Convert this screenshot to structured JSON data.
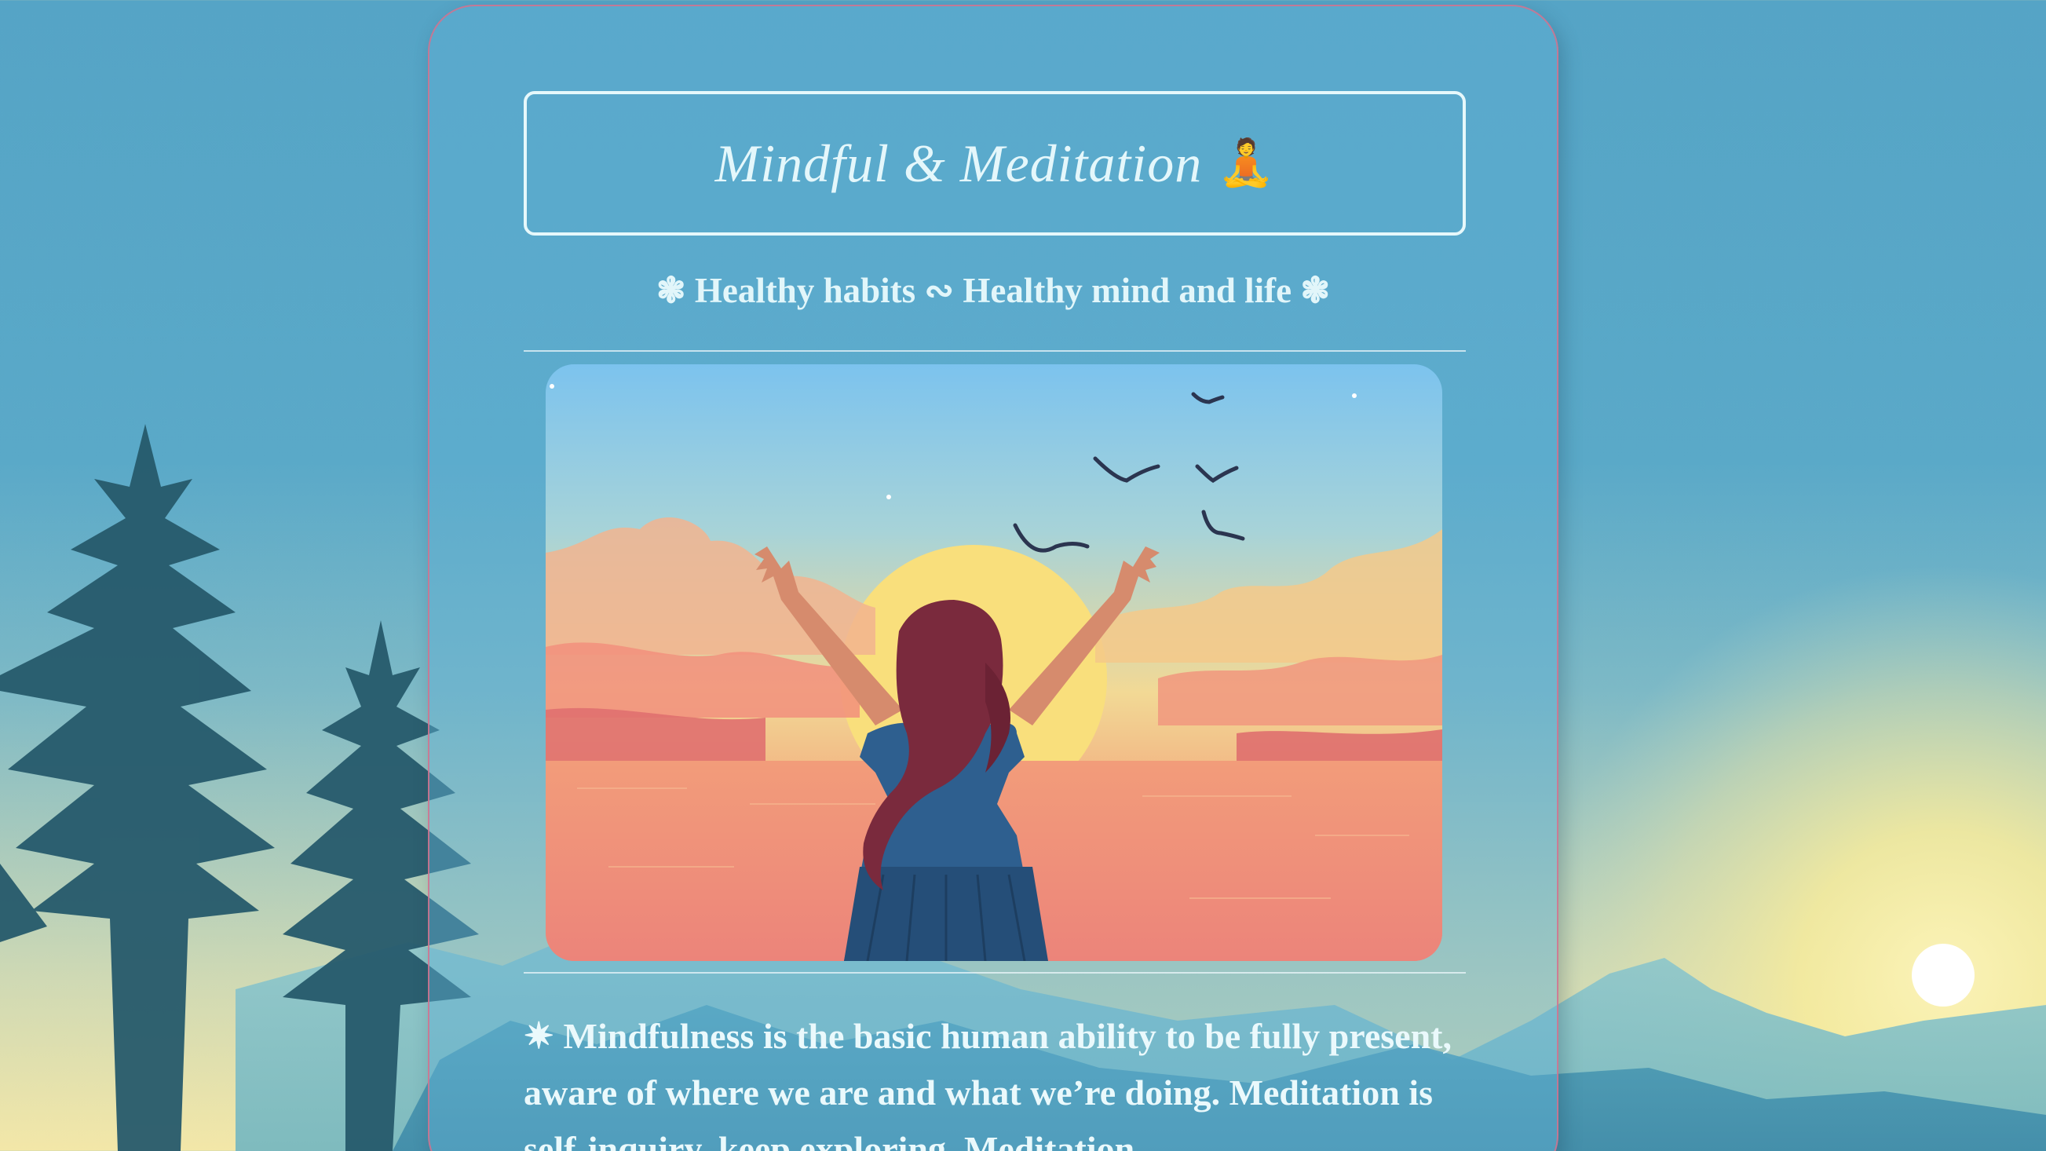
{
  "page": {
    "title": "Mindful & Meditation",
    "title_emoji": "🧘",
    "subtitle": "❃ Healthy habits ∾ Healthy mind and life ❃",
    "body_bullet": "✷",
    "body_text": "Mindfulness is the basic human ability to be fully present, aware of where we are and what we’re doing. Meditation is self-inquiry, keep exploring. Meditation"
  },
  "colors": {
    "card_border": "#d6708c",
    "title_text": "#e4f7fb",
    "background_sky": "#55a4c6",
    "sunset_yellow": "#f8d97a",
    "sunset_pink": "#ec8a7c"
  },
  "icons": {
    "title_icon": "person-in-lotus-position-icon",
    "subtitle_ornament": "flower-ornament-icon",
    "body_bullet": "eight-pointed-star-icon"
  }
}
